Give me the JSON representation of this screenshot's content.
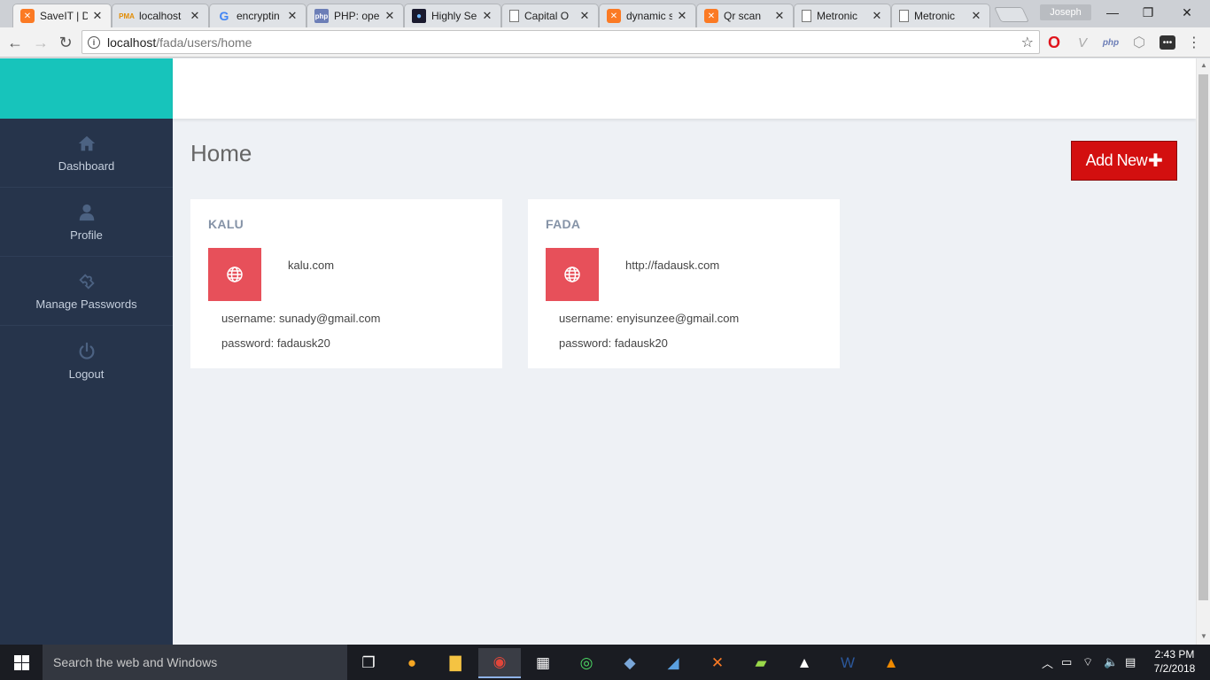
{
  "browser": {
    "tabs": [
      {
        "title": "SaveIT | D",
        "favicon": "xampp-icon",
        "active": true
      },
      {
        "title": "localhost",
        "favicon": "phpmyadmin-icon"
      },
      {
        "title": "encryptin",
        "favicon": "google-icon"
      },
      {
        "title": "PHP: oper",
        "favicon": "php-icon"
      },
      {
        "title": "Highly Se",
        "favicon": "dark-site-icon"
      },
      {
        "title": "Capital O",
        "favicon": "document-icon"
      },
      {
        "title": "dynamic s",
        "favicon": "xampp-icon"
      },
      {
        "title": "Qr scan",
        "favicon": "xampp-icon"
      },
      {
        "title": "Metronic",
        "favicon": "document-icon"
      },
      {
        "title": "Metronic",
        "favicon": "document-icon"
      }
    ],
    "profile_name": "Joseph",
    "url_host": "localhost",
    "url_path": "/fada/users/home"
  },
  "sidebar": {
    "items": [
      {
        "label": "Dashboard",
        "icon": "home-icon"
      },
      {
        "label": "Profile",
        "icon": "user-icon"
      },
      {
        "label": "Manage Passwords",
        "icon": "puzzle-icon"
      },
      {
        "label": "Logout",
        "icon": "power-icon"
      }
    ]
  },
  "main": {
    "title": "Home",
    "add_button": "Add New",
    "add_button_icon": "plus-icon",
    "cards": [
      {
        "name": "KALU",
        "url": "kalu.com",
        "username_label": "username:",
        "username": "sunady@gmail.com",
        "password_label": "password:",
        "password": "fadausk20"
      },
      {
        "name": "FADA",
        "url": "http://fadausk.com",
        "username_label": "username:",
        "username": "enyisunzee@gmail.com",
        "password_label": "password:",
        "password": "fadausk20"
      }
    ]
  },
  "taskbar": {
    "search_placeholder": "Search the web and Windows",
    "time": "2:43 PM",
    "date": "7/2/2018"
  },
  "colors": {
    "brand": "#17c4bb",
    "sidebar": "#26344b",
    "accent_button": "#d30f0f",
    "card_icon": "#e7505a"
  }
}
